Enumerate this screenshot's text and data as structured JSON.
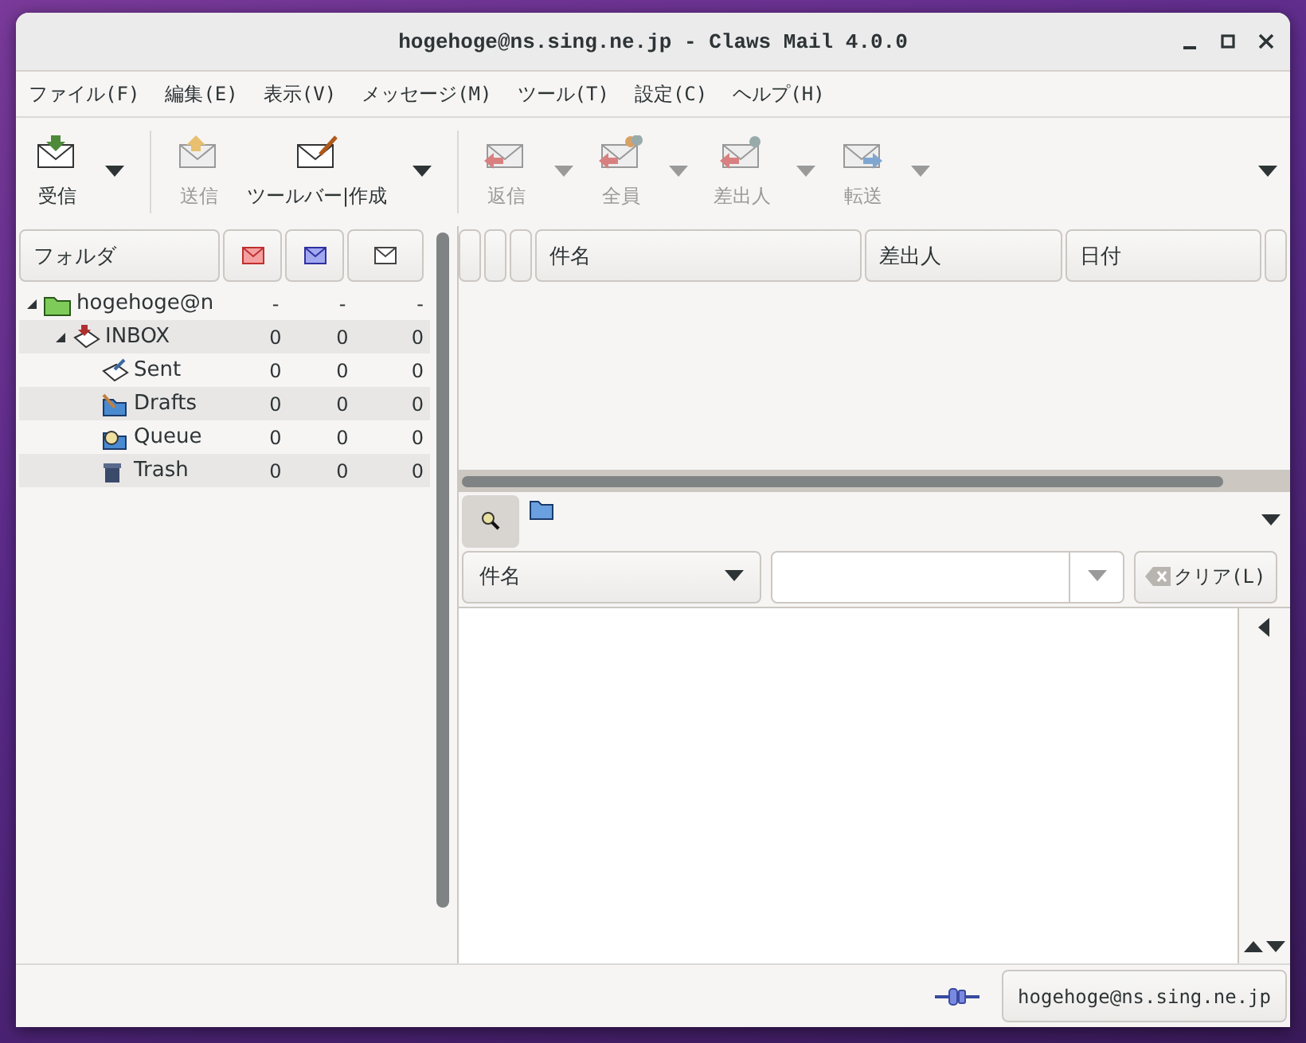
{
  "window": {
    "title": "hogehoge@ns.sing.ne.jp - Claws Mail 4.0.0"
  },
  "menu": [
    "ファイル(F)",
    "編集(E)",
    "表示(V)",
    "メッセージ(M)",
    "ツール(T)",
    "設定(C)",
    "ヘルプ(H)"
  ],
  "toolbar": [
    {
      "kind": "receive",
      "label": "受信",
      "disabled": false,
      "dropdown": true,
      "separator_after": true
    },
    {
      "kind": "send",
      "label": "送信",
      "disabled": true,
      "dropdown": false,
      "separator_after": false
    },
    {
      "kind": "compose",
      "label": "ツールバー|作成",
      "disabled": false,
      "dropdown": true,
      "separator_after": true
    },
    {
      "kind": "reply",
      "label": "返信",
      "disabled": true,
      "dropdown": true,
      "separator_after": false
    },
    {
      "kind": "reply_all",
      "label": "全員",
      "disabled": true,
      "dropdown": true,
      "separator_after": false
    },
    {
      "kind": "reply_sender",
      "label": "差出人",
      "disabled": true,
      "dropdown": true,
      "separator_after": false
    },
    {
      "kind": "forward",
      "label": "転送",
      "disabled": true,
      "dropdown": true,
      "separator_after": false
    }
  ],
  "folder_columns": [
    {
      "kind": "text",
      "label": "フォルダ"
    },
    {
      "kind": "new"
    },
    {
      "kind": "unread"
    },
    {
      "kind": "total"
    }
  ],
  "folders": [
    {
      "kind": "account",
      "name": "hogehoge@n",
      "expanded": true,
      "counts": [
        "-",
        "-",
        "-"
      ],
      "children": [
        {
          "kind": "inbox",
          "name": "INBOX",
          "expanded": true,
          "counts": [
            "0",
            "0",
            "0"
          ],
          "children": [
            {
              "kind": "sent",
              "name": "Sent",
              "counts": [
                "0",
                "0",
                "0"
              ]
            },
            {
              "kind": "drafts",
              "name": "Drafts",
              "counts": [
                "0",
                "0",
                "0"
              ]
            },
            {
              "kind": "queue",
              "name": "Queue",
              "counts": [
                "0",
                "0",
                "0"
              ]
            },
            {
              "kind": "trash",
              "name": "Trash",
              "counts": [
                "0",
                "0",
                "0"
              ]
            }
          ]
        }
      ]
    }
  ],
  "message_columns": [
    {
      "kind": "blank"
    },
    {
      "kind": "blank"
    },
    {
      "kind": "blank"
    },
    {
      "kind": "text",
      "label": "件名"
    },
    {
      "kind": "text",
      "label": "差出人"
    },
    {
      "kind": "text",
      "label": "日付"
    },
    {
      "kind": "cut"
    }
  ],
  "quick_search": {
    "active": true,
    "type": "件名",
    "clear_label": "クリア(L)"
  },
  "status_bar": {
    "account": "hogehoge@ns.sing.ne.jp"
  }
}
